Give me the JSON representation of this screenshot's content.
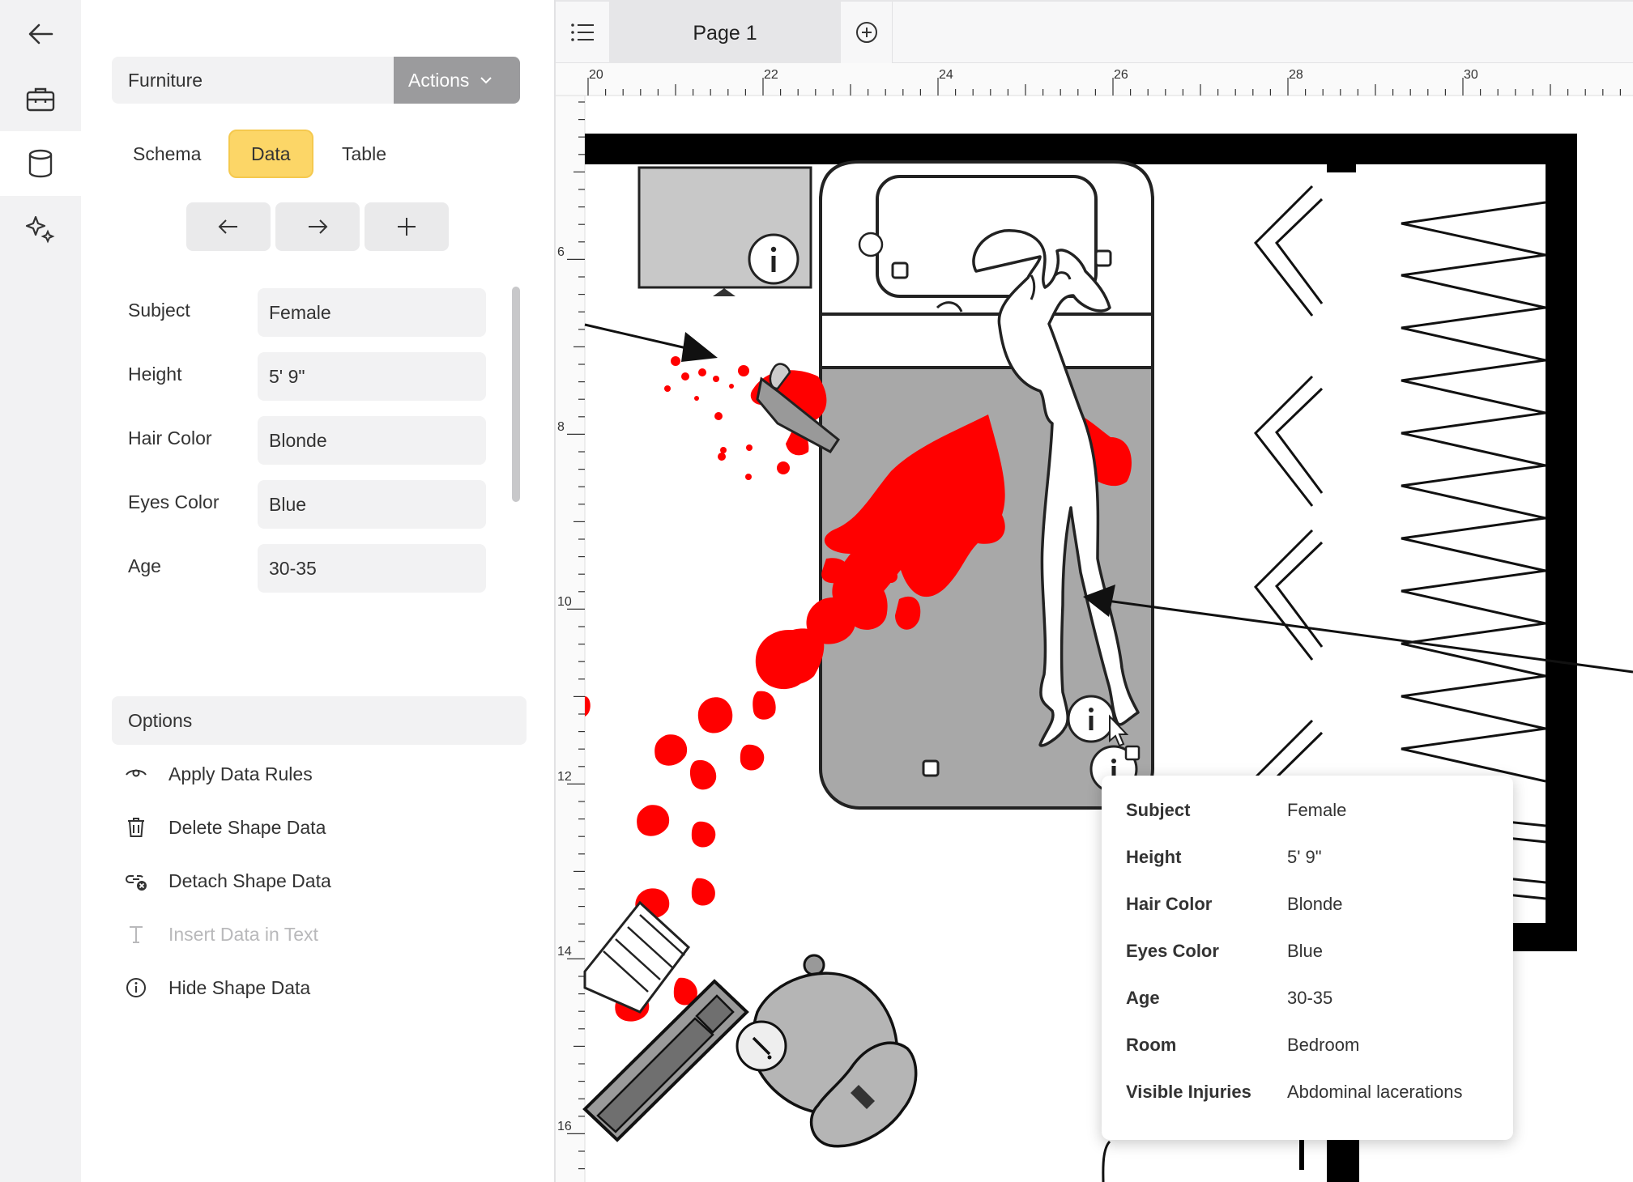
{
  "sidebar": {
    "layer_name": "Furniture",
    "actions_label": "Actions",
    "tabs": [
      {
        "label": "Schema"
      },
      {
        "label": "Data"
      },
      {
        "label": "Table"
      }
    ],
    "active_tab": "Data",
    "fields": [
      {
        "label": "Subject",
        "value": "Female"
      },
      {
        "label": "Height",
        "value": "5' 9\""
      },
      {
        "label": "Hair Color",
        "value": "Blonde"
      },
      {
        "label": "Eyes Color",
        "value": "Blue"
      },
      {
        "label": "Age",
        "value": "30-35"
      }
    ],
    "options_title": "Options",
    "options": [
      {
        "label": "Apply Data Rules",
        "icon": "eye-icon"
      },
      {
        "label": "Delete Shape Data",
        "icon": "trash-icon"
      },
      {
        "label": "Detach Shape Data",
        "icon": "detach-link-icon"
      },
      {
        "label": "Insert Data in Text",
        "icon": "text-icon",
        "disabled": true
      },
      {
        "label": "Hide Shape Data",
        "icon": "info-icon"
      }
    ]
  },
  "pages": {
    "current": "Page 1"
  },
  "ruler": {
    "horizontal": [
      "20",
      "22",
      "24",
      "26",
      "28",
      "30"
    ],
    "vertical": [
      "6",
      "8",
      "10",
      "12",
      "14",
      "16"
    ]
  },
  "tooltip": {
    "rows": [
      {
        "key": "Subject",
        "value": "Female"
      },
      {
        "key": "Height",
        "value": "5' 9\""
      },
      {
        "key": "Hair Color",
        "value": "Blonde"
      },
      {
        "key": "Eyes Color",
        "value": "Blue"
      },
      {
        "key": "Age",
        "value": "30-35"
      },
      {
        "key": "Room",
        "value": "Bedroom"
      },
      {
        "key": "Visible Injuries",
        "value": "Abdominal lacerations"
      }
    ]
  },
  "colors": {
    "accent_tab": "#fcd667",
    "actions_button": "#9b9b9d",
    "blood": "#ff0000",
    "furniture_gray": "#a8a8a8"
  }
}
